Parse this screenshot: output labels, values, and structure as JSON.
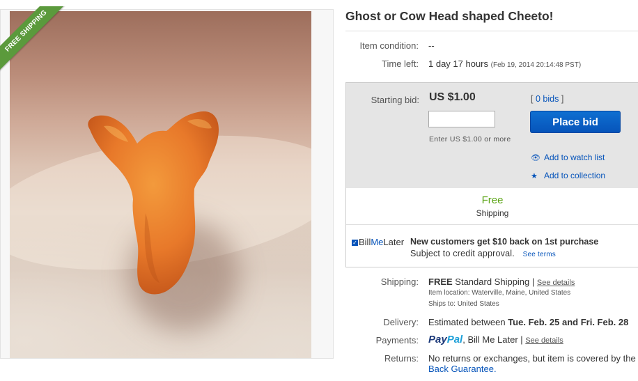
{
  "ribbon": {
    "label": "FREE SHIPPING"
  },
  "item": {
    "title": "Ghost or Cow Head shaped Cheeto!",
    "condition_label": "Item condition:",
    "condition_value": "--",
    "time_left_label": "Time left:",
    "time_left_value": "1 day 17 hours",
    "end_time": "(Feb 19, 2014  20:14:48 PST)"
  },
  "bid": {
    "starting_label": "Starting bid:",
    "price": "US $1.00",
    "input_value": "",
    "input_note": "Enter US $1.00 or more",
    "bids_open": "[",
    "bids_link": "0 bids",
    "bids_close": "]",
    "place_bid_label": "Place bid",
    "watch_label": "Add to watch list",
    "collection_label": "Add to collection"
  },
  "free_shipping": {
    "word": "Free",
    "sub": "Shipping"
  },
  "bill_me_later": {
    "logo_a": "Bill",
    "logo_b": "Me",
    "logo_c": "Later",
    "headline": "New customers get $10 back on 1st purchase",
    "sub": "Subject to credit approval.",
    "terms_link": "See terms"
  },
  "shipping": {
    "label": "Shipping:",
    "free": "FREE",
    "service": "Standard Shipping |",
    "details_link": "See details",
    "location_label": "Item location:",
    "location": "Waterville, Maine, United States",
    "ships_to_label": "Ships to:",
    "ships_to": "United States"
  },
  "delivery": {
    "label": "Delivery:",
    "prefix": "Estimated between",
    "dates": "Tue. Feb. 25 and Fri. Feb. 28"
  },
  "payments": {
    "label": "Payments:",
    "paypal_a": "Pay",
    "paypal_b": "Pal",
    "other": ", Bill Me Later |",
    "details_link": "See details"
  },
  "returns": {
    "label": "Returns:",
    "text": "No returns or exchanges, but item is covered by the",
    "link": "Back Guarantee."
  },
  "colors": {
    "accent_blue": "#0654ba",
    "free_green": "#5ba415",
    "ribbon_green": "#5b9a3c",
    "cheeto_orange": "#e8792a"
  }
}
